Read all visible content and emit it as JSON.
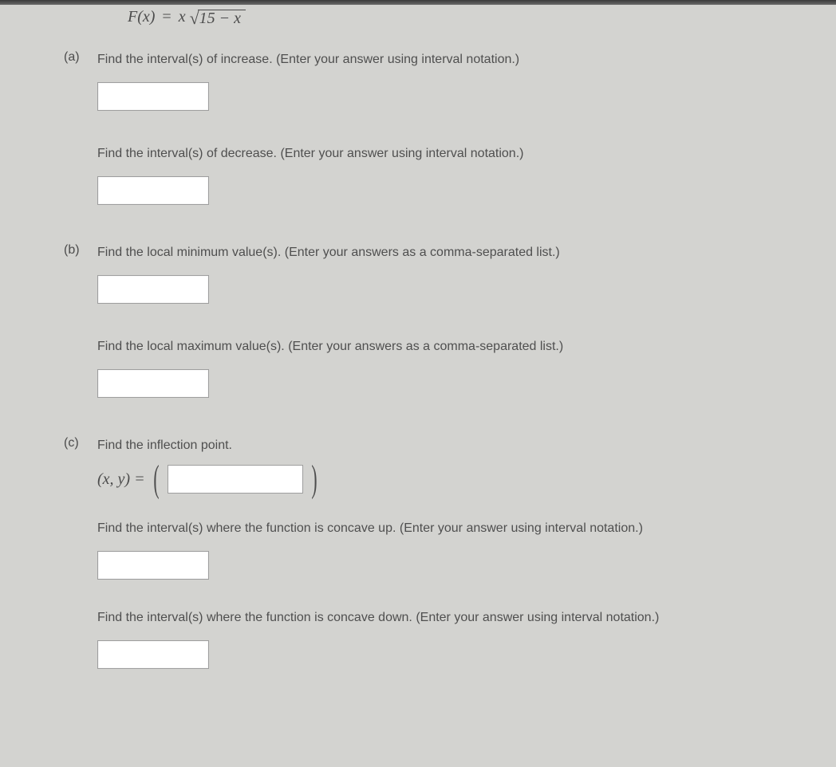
{
  "formula": {
    "lhs": "F(x)",
    "eq": "=",
    "x": "x",
    "radicand": "15 − x"
  },
  "parts": {
    "a": {
      "label": "(a)",
      "q1": "Find the interval(s) of increase. (Enter your answer using interval notation.)",
      "q2": "Find the interval(s) of decrease. (Enter your answer using interval notation.)"
    },
    "b": {
      "label": "(b)",
      "q1": "Find the local minimum value(s). (Enter your answers as a comma-separated list.)",
      "q2": "Find the local maximum value(s). (Enter your answers as a comma-separated list.)"
    },
    "c": {
      "label": "(c)",
      "q1": "Find the inflection point.",
      "xy": "(x, y) =",
      "q2": "Find the interval(s) where the function is concave up. (Enter your answer using interval notation.)",
      "q3": "Find the interval(s) where the function is concave down. (Enter your answer using interval notation.)"
    }
  }
}
